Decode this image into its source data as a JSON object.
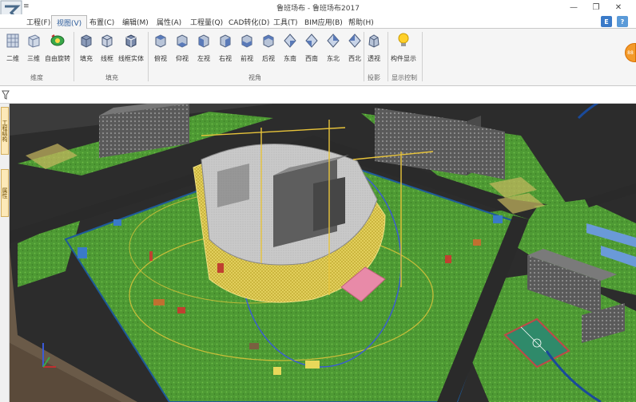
{
  "window": {
    "title": "鲁班场布 - 鲁班场布2017",
    "quick_access": "≡",
    "minimize": "—",
    "restore": "❐",
    "close": "✕"
  },
  "menu": {
    "items": [
      {
        "label": "工程(F)"
      },
      {
        "label": "视图(V)"
      },
      {
        "label": "布置(C)"
      },
      {
        "label": "编辑(M)"
      },
      {
        "label": "属性(A)"
      },
      {
        "label": "工程量(Q)"
      },
      {
        "label": "CAD转化(D)"
      },
      {
        "label": "工具(T)"
      },
      {
        "label": "BIM应用(B)"
      },
      {
        "label": "帮助(H)"
      }
    ],
    "right_icons": [
      {
        "glyph": "E"
      },
      {
        "glyph": "?"
      }
    ]
  },
  "ribbon": {
    "buttons": [
      {
        "label": "二维"
      },
      {
        "label": "三维"
      },
      {
        "label": "自由旋转"
      },
      {
        "label": "填充"
      },
      {
        "label": "线框"
      },
      {
        "label": "线框实体"
      },
      {
        "label": "俯视"
      },
      {
        "label": "仰视"
      },
      {
        "label": "左视"
      },
      {
        "label": "右视"
      },
      {
        "label": "前视"
      },
      {
        "label": "后视"
      },
      {
        "label": "东南"
      },
      {
        "label": "西南"
      },
      {
        "label": "东北"
      },
      {
        "label": "西北"
      },
      {
        "label": "透视"
      },
      {
        "label": "构件显示"
      }
    ],
    "groups": [
      {
        "label": "维度"
      },
      {
        "label": "填充"
      },
      {
        "label": "视角"
      },
      {
        "label": "投影"
      },
      {
        "label": "显示控制"
      }
    ]
  },
  "side_tabs": [
    {
      "label": "工程结构"
    },
    {
      "label": "属性"
    }
  ],
  "float_badge": "88",
  "colors": {
    "grass": "#4e9a34",
    "road": "#2a2a2a",
    "scaffold": "#d9c44a",
    "building": "#5a5a5a",
    "court": "#2f8a6a"
  }
}
